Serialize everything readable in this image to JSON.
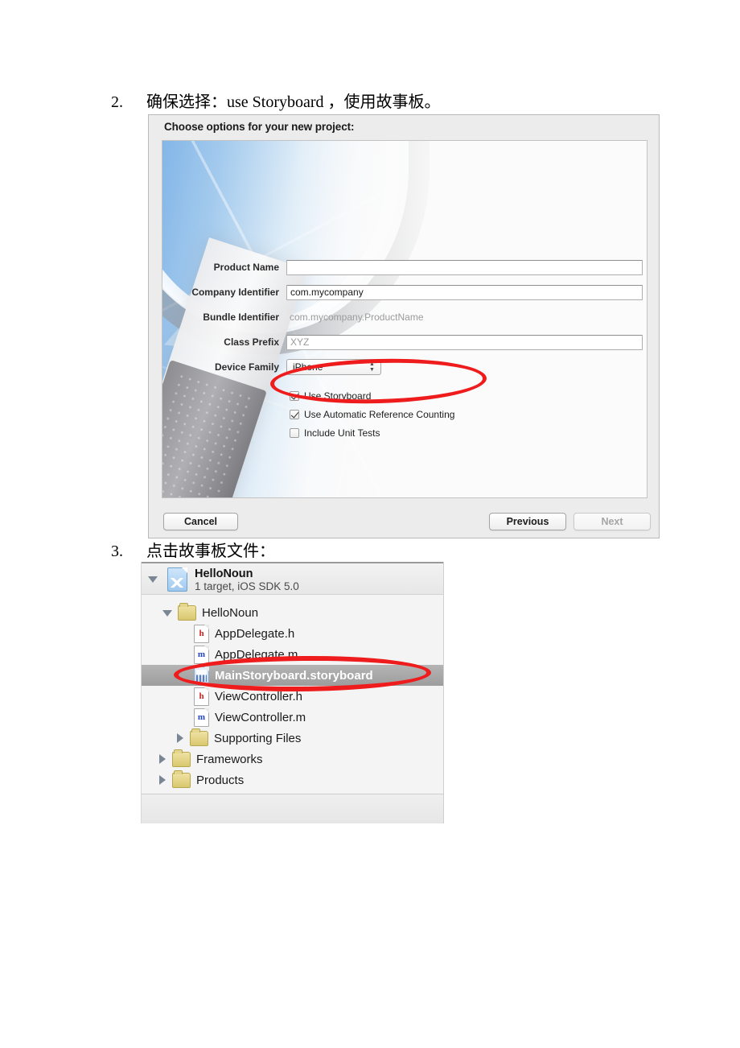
{
  "steps": [
    {
      "number": "2.",
      "text": "确保选择：use Storyboard ，使用故事板。"
    },
    {
      "number": "3.",
      "text": "点击故事板文件："
    }
  ],
  "dialog": {
    "title": "Choose options for your new project:",
    "fields": [
      {
        "label": "Product Name",
        "value": "",
        "placeholder": "",
        "type": "input"
      },
      {
        "label": "Company Identifier",
        "value": "com.mycompany",
        "placeholder": "",
        "type": "input"
      },
      {
        "label": "Bundle Identifier",
        "value": "com.mycompany.ProductName",
        "type": "static"
      },
      {
        "label": "Class Prefix",
        "value": "",
        "placeholder": "XYZ",
        "type": "input"
      },
      {
        "label": "Device Family",
        "value": "iPhone",
        "type": "popup"
      }
    ],
    "checkboxes": [
      {
        "label": "Use Storyboard",
        "checked": true
      },
      {
        "label": "Use Automatic Reference Counting",
        "checked": true
      },
      {
        "label": "Include Unit Tests",
        "checked": false
      }
    ],
    "buttons": {
      "cancel": "Cancel",
      "previous": "Previous",
      "next": "Next"
    },
    "popup_arrows": {
      "up": "▲",
      "down": "▼"
    }
  },
  "navigator": {
    "project": {
      "name": "HelloNoun",
      "subtitle": "1 target, iOS SDK 5.0"
    },
    "rows": [
      {
        "label": "HelloNoun",
        "icon": "folder-icon",
        "disclosure": "open",
        "indent": 0,
        "selected": false
      },
      {
        "label": "AppDelegate.h",
        "icon": "header-file-icon",
        "badge": "h",
        "disclosure": "none",
        "indent": 1,
        "selected": false
      },
      {
        "label": "AppDelegate.m",
        "icon": "implementation-file-icon",
        "badge": "m",
        "disclosure": "none",
        "indent": 1,
        "selected": false
      },
      {
        "label": "MainStoryboard.storyboard",
        "icon": "storyboard-file-icon",
        "badge": "",
        "disclosure": "none",
        "indent": 1,
        "selected": true
      },
      {
        "label": "ViewController.h",
        "icon": "header-file-icon",
        "badge": "h",
        "disclosure": "none",
        "indent": 1,
        "selected": false
      },
      {
        "label": "ViewController.m",
        "icon": "implementation-file-icon",
        "badge": "m",
        "disclosure": "none",
        "indent": 1,
        "selected": false
      },
      {
        "label": "Supporting Files",
        "icon": "folder-icon",
        "disclosure": "closed",
        "indent": 1,
        "selected": false
      },
      {
        "label": "Frameworks",
        "icon": "folder-icon",
        "disclosure": "closed",
        "indent": 0,
        "selected": false
      },
      {
        "label": "Products",
        "icon": "folder-icon",
        "disclosure": "closed",
        "indent": 0,
        "selected": false
      }
    ]
  },
  "annotations": {
    "ellipse_color": "#ee1c1c",
    "ellipse_targets": [
      "use-storyboard-and-arc-checkboxes",
      "mainstoryboard-file-row"
    ]
  }
}
